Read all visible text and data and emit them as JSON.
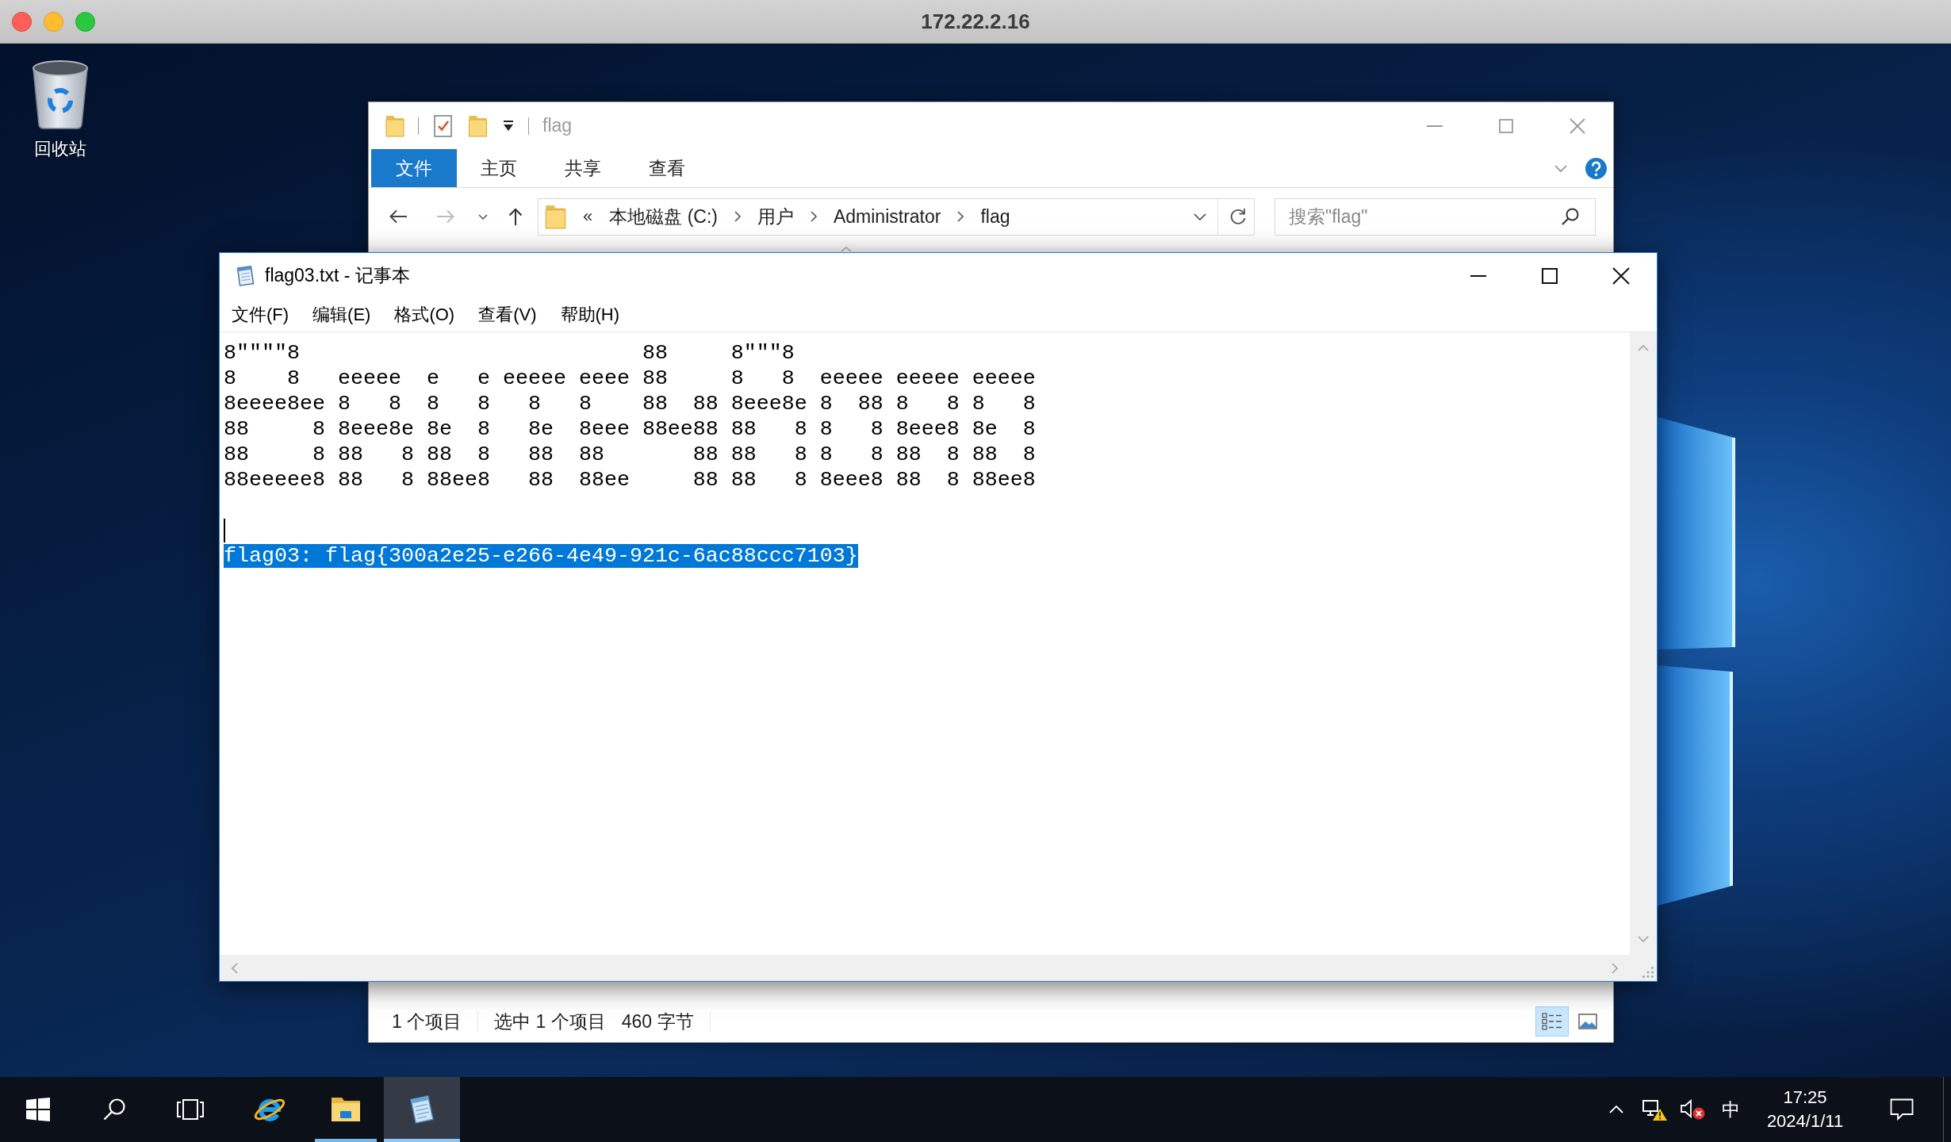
{
  "host_window": {
    "title": "172.22.2.16"
  },
  "desktop": {
    "recycle_bin": {
      "label": "回收站"
    }
  },
  "explorer": {
    "title": "flag",
    "ribbon_tabs": [
      {
        "label": "文件",
        "kind": "file-menu",
        "selected": false
      },
      {
        "label": "主页",
        "kind": "tab",
        "selected": false
      },
      {
        "label": "共享",
        "kind": "tab",
        "selected": false
      },
      {
        "label": "查看",
        "kind": "tab",
        "selected": false
      }
    ],
    "address": {
      "overflow": "«",
      "crumbs": [
        "本地磁盘 (C:)",
        "用户",
        "Administrator",
        "flag"
      ]
    },
    "search": {
      "placeholder": "搜索\"flag\""
    },
    "status_bar": [
      [
        "1 个项目"
      ],
      [
        "选中 1 个项目",
        "460 字节"
      ]
    ],
    "view_buttons": [
      {
        "kind": "details",
        "selected": true
      },
      {
        "kind": "large-icons",
        "selected": false
      }
    ]
  },
  "notepad": {
    "title": "flag03.txt - 记事本",
    "menu": [
      "文件(F)",
      "编辑(E)",
      "格式(O)",
      "查看(V)",
      "帮助(H)"
    ],
    "lines": [
      {
        "kind": "text",
        "text": "8\"\"\"\"8                           88     8\"\"\"8",
        "selected": false,
        "cursor": false
      },
      {
        "kind": "text",
        "text": "8    8   eeeee  e   e eeeee eeee 88     8   8  eeeee eeeee eeeee",
        "selected": false,
        "cursor": false
      },
      {
        "kind": "text",
        "text": "8eeee8ee 8   8  8   8   8   8    88  88 8eee8e 8  88 8   8 8   8",
        "selected": false,
        "cursor": false
      },
      {
        "kind": "text",
        "text": "88     8 8eee8e 8e  8   8e  8eee 88ee88 88   8 8   8 8eee8 8e  8",
        "selected": false,
        "cursor": false
      },
      {
        "kind": "text",
        "text": "88     8 88   8 88  8   88  88       88 88   8 8   8 88  8 88  8",
        "selected": false,
        "cursor": false
      },
      {
        "kind": "text",
        "text": "88eeeee8 88   8 88ee8   88  88ee     88 88   8 8eee8 88  8 88ee8",
        "selected": false,
        "cursor": false
      },
      {
        "kind": "blank",
        "selected": false,
        "cursor": false
      },
      {
        "kind": "blank",
        "selected": false,
        "cursor": true
      },
      {
        "kind": "text",
        "text": "flag03: flag{300a2e25-e266-4e49-921c-6ac88ccc7103}",
        "selected": true,
        "cursor": false
      }
    ]
  },
  "taskbar": {
    "apps": [
      {
        "kind": "browser",
        "running": false,
        "active": false
      },
      {
        "kind": "file-explorer",
        "running": true,
        "active": false
      },
      {
        "kind": "notepad",
        "running": true,
        "active": true
      }
    ],
    "tray": {
      "ime": "中",
      "time": "17:25",
      "date": "2024/1/11"
    }
  }
}
